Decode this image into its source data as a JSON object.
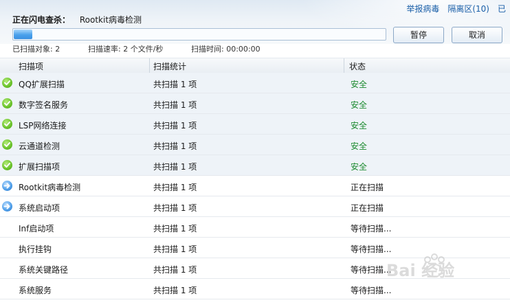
{
  "toplinks": [
    "举报病毒",
    "隔离区(10)",
    "已"
  ],
  "scan": {
    "label": "正在闪电查杀：",
    "current_item": "Rootkit病毒检测",
    "progress_percent": 5
  },
  "buttons": {
    "pause": "暂停",
    "cancel": "取消"
  },
  "stats": {
    "scanned": "已扫描对象: 2",
    "rate": "扫描速率: 2 个文件/秒",
    "time": "扫描时间: 00:00:00"
  },
  "columns": [
    "扫描项",
    "扫描统计",
    "状态"
  ],
  "rows": [
    {
      "name": "QQ扩展扫描",
      "count": "共扫描 1 项",
      "status": "安全",
      "icon": "check-icon",
      "state": "done"
    },
    {
      "name": "数字签名服务",
      "count": "共扫描 1 项",
      "status": "安全",
      "icon": "check-icon",
      "state": "done"
    },
    {
      "name": "LSP网络连接",
      "count": "共扫描 1 项",
      "status": "安全",
      "icon": "check-icon",
      "state": "done"
    },
    {
      "name": "云通道检测",
      "count": "共扫描 1 项",
      "status": "安全",
      "icon": "check-icon",
      "state": "done"
    },
    {
      "name": "扩展扫描项",
      "count": "共扫描 1 项",
      "status": "安全",
      "icon": "check-icon",
      "state": "done"
    },
    {
      "name": "Rootkit病毒检测",
      "count": "共扫描 1 项",
      "status": "正在扫描",
      "icon": "arrow-right-icon",
      "state": "scanning"
    },
    {
      "name": "系统启动项",
      "count": "共扫描 1 项",
      "status": "正在扫描",
      "icon": "arrow-right-icon",
      "state": "scanning"
    },
    {
      "name": "Inf启动项",
      "count": "共扫描 1 项",
      "status": "等待扫描...",
      "icon": "",
      "state": "waiting"
    },
    {
      "name": "执行挂钩",
      "count": "共扫描 1 项",
      "status": "等待扫描...",
      "icon": "",
      "state": "waiting"
    },
    {
      "name": "系统关键路径",
      "count": "共扫描 1 项",
      "status": "等待扫描...",
      "icon": "",
      "state": "waiting"
    },
    {
      "name": "系统服务",
      "count": "共扫描 1 项",
      "status": "等待扫描...",
      "icon": "",
      "state": "waiting"
    }
  ],
  "colors": {
    "safe": "#1b8a2e",
    "link": "#1a5fa8",
    "progress": "#4aa1ec"
  },
  "watermark": "Bai 经验"
}
